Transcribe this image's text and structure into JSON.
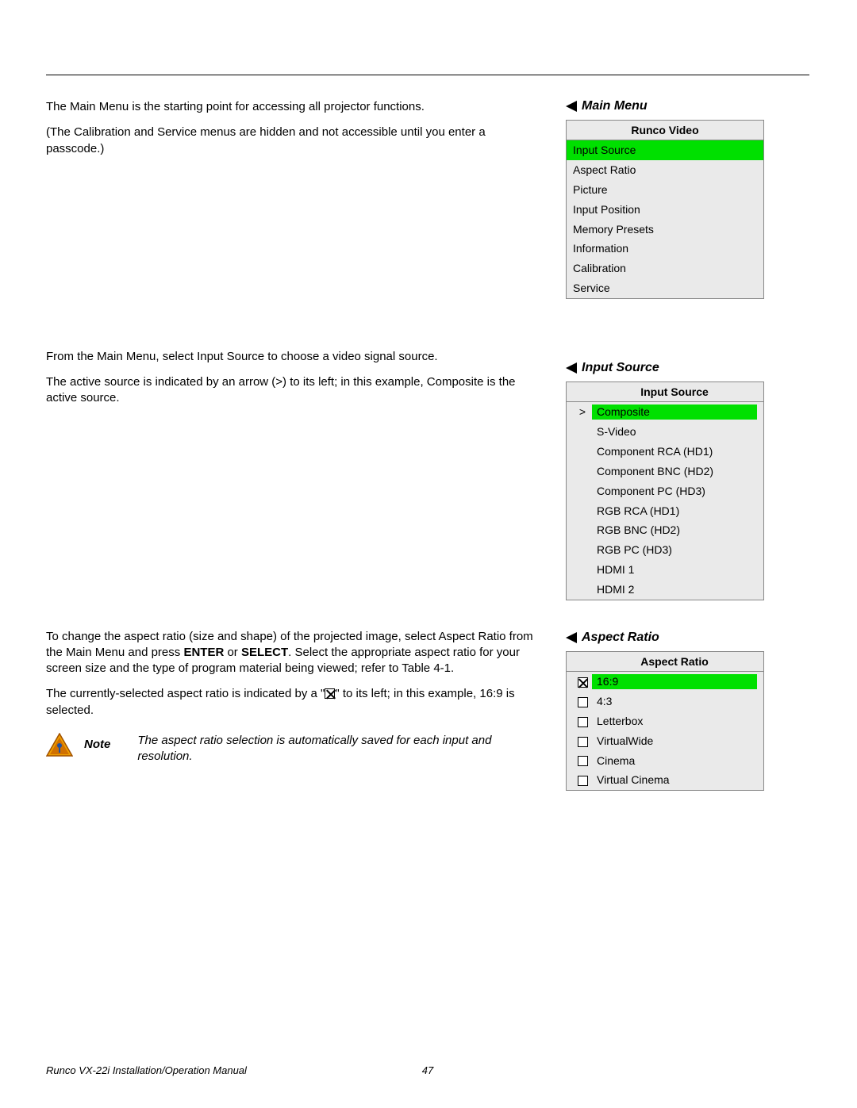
{
  "body": {
    "p1": "The Main Menu is the starting point for accessing all projector functions.",
    "p2": "(The Calibration and Service menus are hidden and not accessible until you enter a passcode.)",
    "p3": "From the Main Menu, select Input Source to choose a video signal source.",
    "p4": "The active source is indicated by an arrow (>) to its left; in this example, Composite is the active source.",
    "p5a": "To change the aspect ratio (size and shape) of the projected image, select Aspect Ratio from the Main Menu and press ",
    "p5_enter": "ENTER",
    "p5_or": " or ",
    "p5_select": "SELECT",
    "p5b": ". Select the appropriate aspect ratio for your screen size and the type of program material being viewed; refer to Table 4-1.",
    "p6a": "The currently-selected aspect ratio is indicated by a \"",
    "p6b": "\" to its left; in this example, 16:9 is selected.",
    "note_label": "Note",
    "note_text": "The aspect ratio selection is automatically saved for each input and resolution."
  },
  "sections": {
    "main_menu": "Main Menu",
    "input_source": "Input Source",
    "aspect_ratio": "Aspect Ratio"
  },
  "menus": {
    "main": {
      "title": "Runco Video",
      "items": [
        {
          "label": "Input Source",
          "selected": true
        },
        {
          "label": "Aspect Ratio"
        },
        {
          "label": "Picture"
        },
        {
          "label": "Input Position"
        },
        {
          "label": "Memory Presets"
        },
        {
          "label": "Information"
        },
        {
          "label": "Calibration"
        },
        {
          "label": "Service"
        }
      ]
    },
    "input_source": {
      "title": "Input Source",
      "items": [
        {
          "label": "Composite",
          "indicator": ">",
          "selected": true
        },
        {
          "label": "S-Video"
        },
        {
          "label": "Component RCA (HD1)"
        },
        {
          "label": "Component BNC (HD2)"
        },
        {
          "label": "Component PC (HD3)"
        },
        {
          "label": "RGB RCA (HD1)"
        },
        {
          "label": "RGB BNC (HD2)"
        },
        {
          "label": "RGB PC (HD3)"
        },
        {
          "label": "HDMI 1"
        },
        {
          "label": "HDMI 2"
        }
      ]
    },
    "aspect_ratio": {
      "title": "Aspect Ratio",
      "items": [
        {
          "label": "16:9",
          "checked": true,
          "selected": true
        },
        {
          "label": "4:3"
        },
        {
          "label": "Letterbox"
        },
        {
          "label": "VirtualWide"
        },
        {
          "label": "Cinema"
        },
        {
          "label": "Virtual Cinema"
        }
      ]
    }
  },
  "footer": {
    "title": "Runco VX-22i Installation/Operation Manual",
    "page": "47"
  }
}
